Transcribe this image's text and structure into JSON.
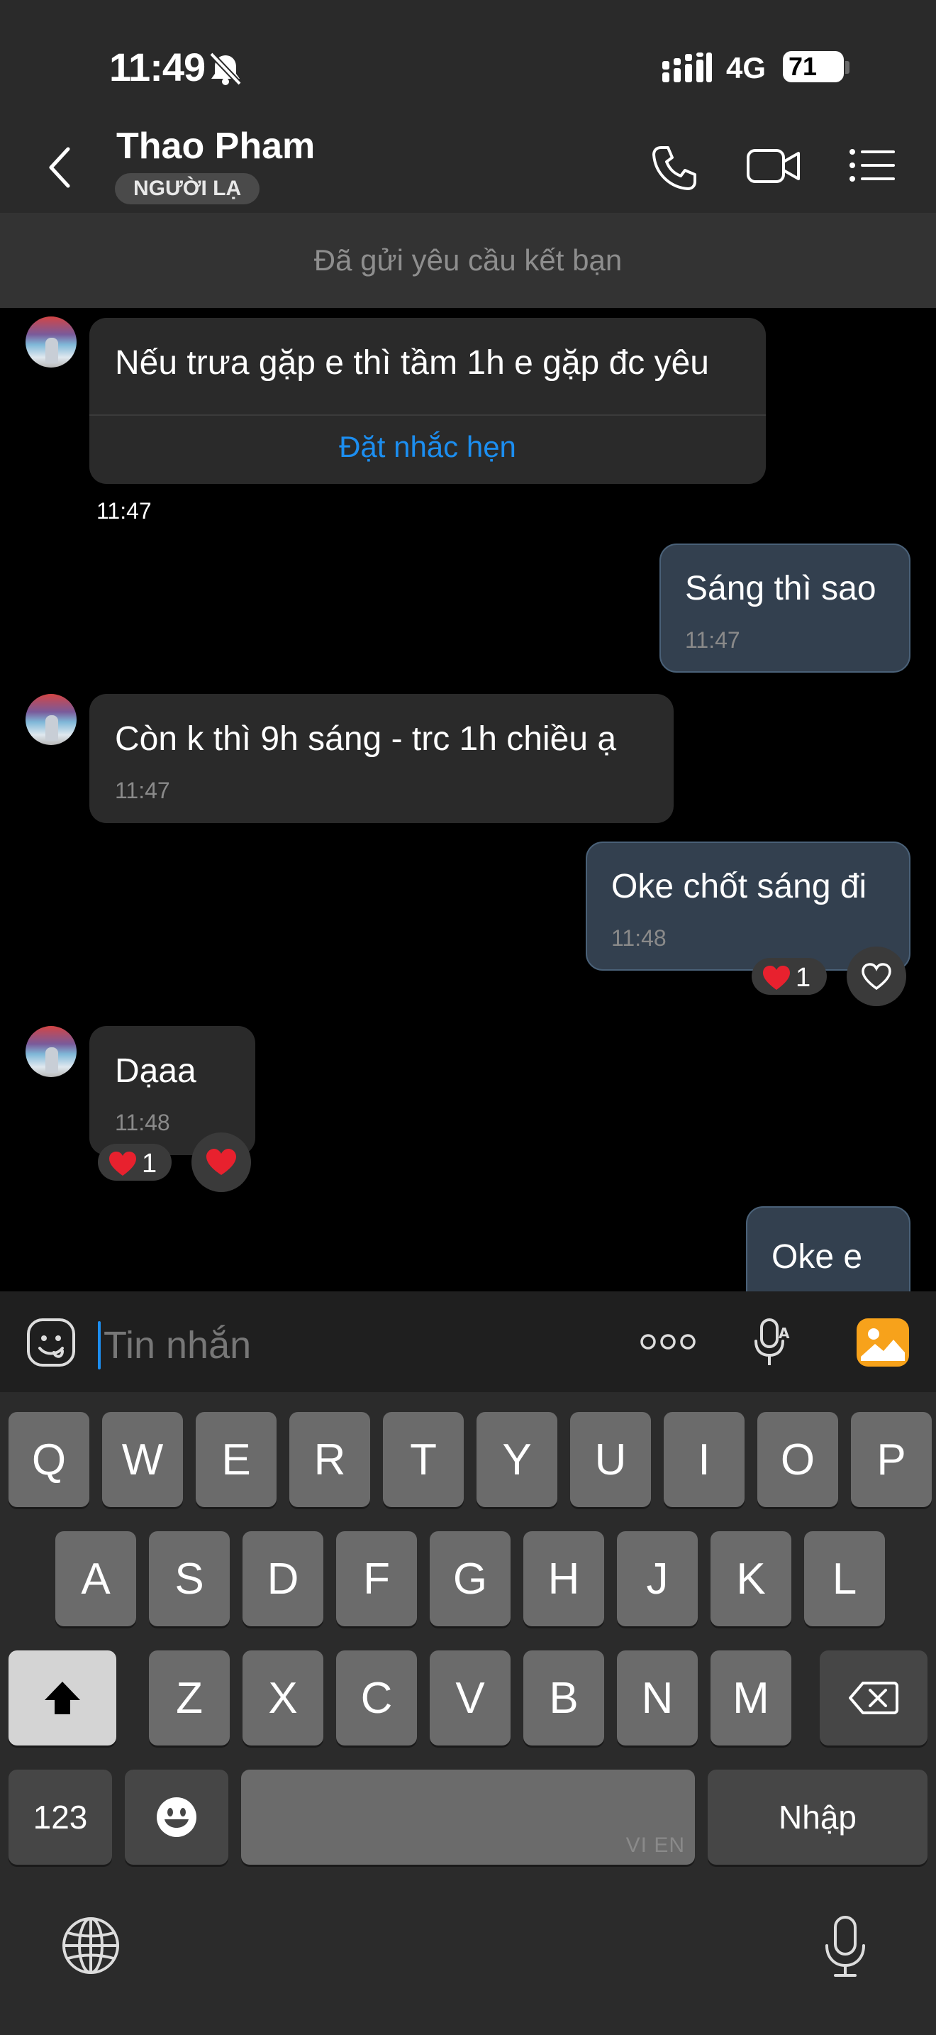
{
  "status_bar": {
    "time": "11:49",
    "network": "4G",
    "battery": "71"
  },
  "header": {
    "contact_name": "Thao Pham",
    "badge": "NGƯỜI LẠ"
  },
  "banner": {
    "text": "Đã gửi yêu cầu kết bạn"
  },
  "messages": [
    {
      "direction": "in",
      "text": "Nếu trưa gặp e thì tầm 1h e gặp đc yêu",
      "action": "Đặt nhắc hẹn",
      "time": "11:47"
    },
    {
      "direction": "out",
      "text": "Sáng thì sao",
      "time": "11:47"
    },
    {
      "direction": "in",
      "text": "Còn k thì 9h sáng - trc 1h chiều ạ",
      "time": "11:47"
    },
    {
      "direction": "out",
      "text": "Oke chốt sáng đi",
      "time": "11:48",
      "reaction_count": "1"
    },
    {
      "direction": "in",
      "text": "Dạaa",
      "time": "11:48",
      "reaction_count": "1"
    },
    {
      "direction": "out",
      "text": "Oke e"
    }
  ],
  "composer": {
    "placeholder": "Tin nhắn"
  },
  "keyboard": {
    "row1": [
      "Q",
      "W",
      "E",
      "R",
      "T",
      "Y",
      "U",
      "I",
      "O",
      "P"
    ],
    "row2": [
      "A",
      "S",
      "D",
      "F",
      "G",
      "H",
      "J",
      "K",
      "L"
    ],
    "row3": [
      "Z",
      "X",
      "C",
      "V",
      "B",
      "N",
      "M"
    ],
    "numbers_label": "123",
    "space_hint": "VI EN",
    "return_label": "Nhập"
  },
  "colors": {
    "accent": "#1c8ef0",
    "outgoing_bubble": "#33404f",
    "incoming_bubble": "#2a2a2a",
    "image_button": "#f7a21b",
    "heart": "#e8212e"
  }
}
